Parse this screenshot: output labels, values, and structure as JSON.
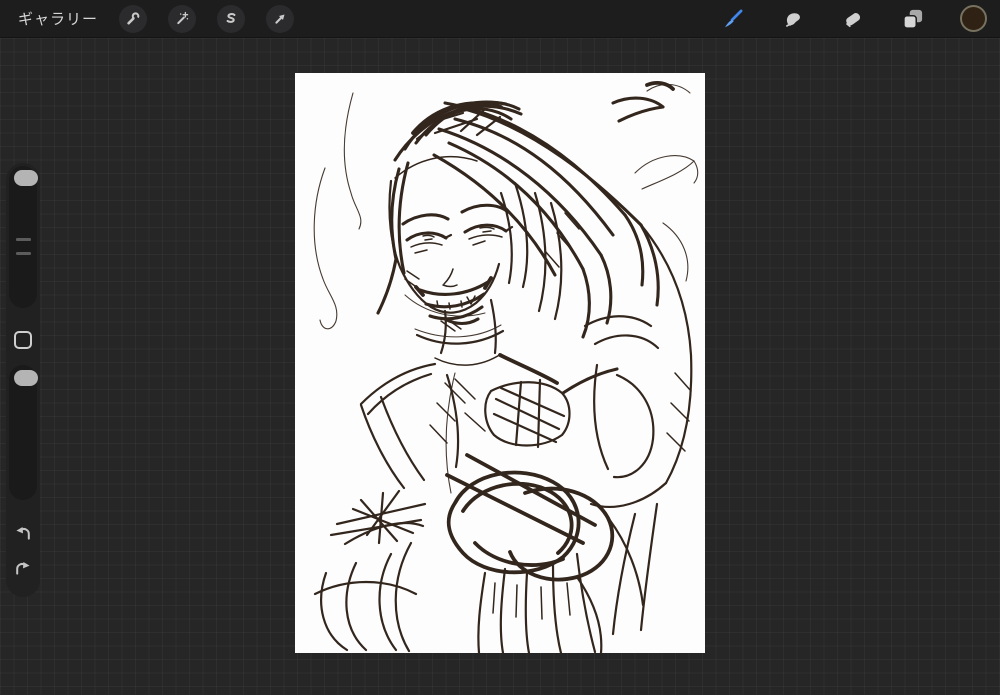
{
  "app_title": "Procreate-style painting app canvas view",
  "topbar": {
    "gallery_label": "ギャラリー",
    "left_tools": [
      {
        "id": "actions",
        "icon": "wrench-icon"
      },
      {
        "id": "adjustments",
        "icon": "magic-wand-icon"
      },
      {
        "id": "selection",
        "icon": "s-selection-icon"
      },
      {
        "id": "transform",
        "icon": "arrow-cursor-icon"
      }
    ],
    "right_tools": [
      {
        "id": "paint",
        "icon": "brush-icon",
        "active": true
      },
      {
        "id": "smudge",
        "icon": "smudge-finger-icon",
        "active": false
      },
      {
        "id": "erase",
        "icon": "eraser-icon",
        "active": false
      },
      {
        "id": "layers",
        "icon": "layers-icon",
        "active": false
      },
      {
        "id": "color",
        "icon": "color-swatch",
        "current_color": "#2f2113"
      }
    ]
  },
  "sidebar": {
    "brush_size_slider": {
      "handle_position": "top"
    },
    "opacity_slider": {
      "handle_position": "top"
    },
    "modify_button": {
      "icon": "square-icon"
    },
    "undo_button": {
      "icon": "undo-arrow-icon"
    },
    "redo_button": {
      "icon": "redo-arrow-icon"
    }
  },
  "canvas": {
    "background": "#fdfdfd",
    "ink_color": "#33261d",
    "description": "Rough sepia pencil sketch of a grinning long-haired character, hair sweeping to the right, arms crossed low with heavy circular scribbles"
  },
  "colors": {
    "topbar_bg": "#1d1d1e",
    "workspace_bg": "#262626",
    "grid_line": "rgba(255,255,255,0.035)",
    "tool_circle_bg": "#2b2b2d",
    "icon_gray": "#c9c9c9",
    "accent_brush_blue": "#3f87ea",
    "sidebar_bg": "#212122",
    "slider_handle": "#b4b4b4",
    "swatch_brown": "#2f2113"
  }
}
